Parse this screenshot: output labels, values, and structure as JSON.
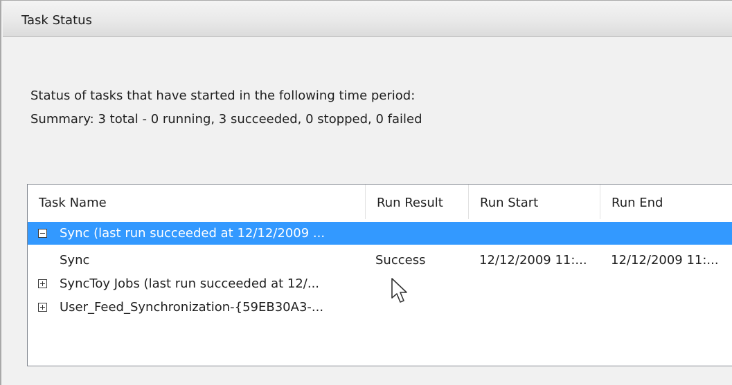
{
  "section": {
    "title": "Task Status"
  },
  "description": "Status of tasks that have started in the following time period:",
  "summary": "Summary: 3 total - 0 running, 3 succeeded, 0 stopped, 0 failed",
  "grid": {
    "columns": [
      "Task Name",
      "Run Result",
      "Run Start",
      "Run End"
    ],
    "rows": [
      {
        "kind": "group",
        "state": "expanded",
        "selected": true,
        "task_name": "Sync (last run succeeded at 12/12/2009 ...",
        "run_result": "",
        "run_start": "",
        "run_end": ""
      },
      {
        "kind": "item",
        "selected": false,
        "task_name": "Sync",
        "run_result": "Success",
        "run_start": "12/12/2009 11:...",
        "run_end": "12/12/2009 11:..."
      },
      {
        "kind": "group",
        "state": "collapsed",
        "selected": false,
        "task_name": "SyncToy Jobs (last run succeeded at 12/...",
        "run_result": "",
        "run_start": "",
        "run_end": ""
      },
      {
        "kind": "group",
        "state": "collapsed",
        "selected": false,
        "task_name": "User_Feed_Synchronization-{59EB30A3-...",
        "run_result": "",
        "run_start": "",
        "run_end": ""
      }
    ]
  },
  "icons": {
    "expanded": "minus-box",
    "collapsed": "plus-box",
    "pointer": "mouse-pointer"
  },
  "colors": {
    "selection": "#3399ff",
    "selection_text": "#ffffff"
  }
}
